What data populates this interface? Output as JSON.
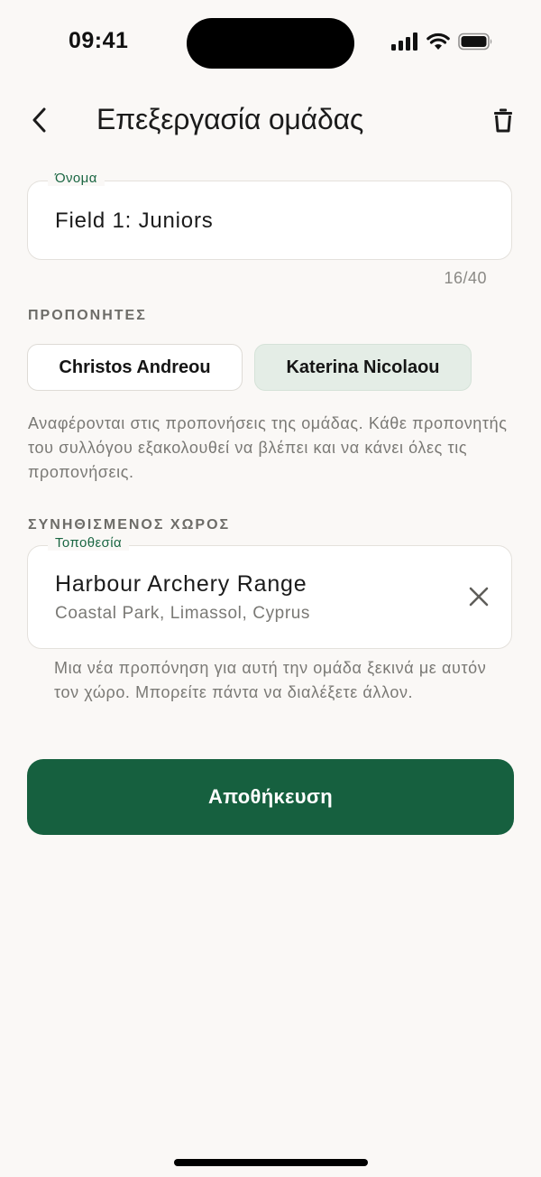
{
  "status_bar": {
    "time": "09:41"
  },
  "header": {
    "title": "Επεξεργασία ομάδας",
    "back_icon": "chevron-left-icon",
    "delete_icon": "trash-icon"
  },
  "name_field": {
    "label": "Όνομα",
    "value": "Field 1: Juniors",
    "char_count": "16/40"
  },
  "coaches": {
    "section_label": "ΠΡΟΠΟΝΗΤΕΣ",
    "chips": [
      {
        "label": "Christos Andreou",
        "selected": false
      },
      {
        "label": "Katerina Nicolaou",
        "selected": true
      }
    ],
    "help_text": "Αναφέρονται στις προπονήσεις της ομάδας. Κάθε προπονητής του συλλόγου εξακολουθεί να βλέπει και να κάνει όλες τις προπονήσεις."
  },
  "venue": {
    "section_label": "ΣΥΝΗΘΙΣΜΕΝΟΣ ΧΩΡΟΣ",
    "field_label": "Τοποθεσία",
    "name": "Harbour Archery Range",
    "address": "Coastal Park, Limassol, Cyprus",
    "clear_icon": "close-icon",
    "help_text": "Μια νέα προπόνηση για αυτή την ομάδα ξεκινά με αυτόν τον χώρο. Μπορείτε πάντα να διαλέξετε άλλον."
  },
  "save_button": {
    "label": "Αποθήκευση"
  },
  "colors": {
    "background": "#faf8f6",
    "accent": "#16603f",
    "label_green": "#1a6642",
    "selected_chip": "#e4ede6",
    "muted_text": "#7a7975"
  }
}
